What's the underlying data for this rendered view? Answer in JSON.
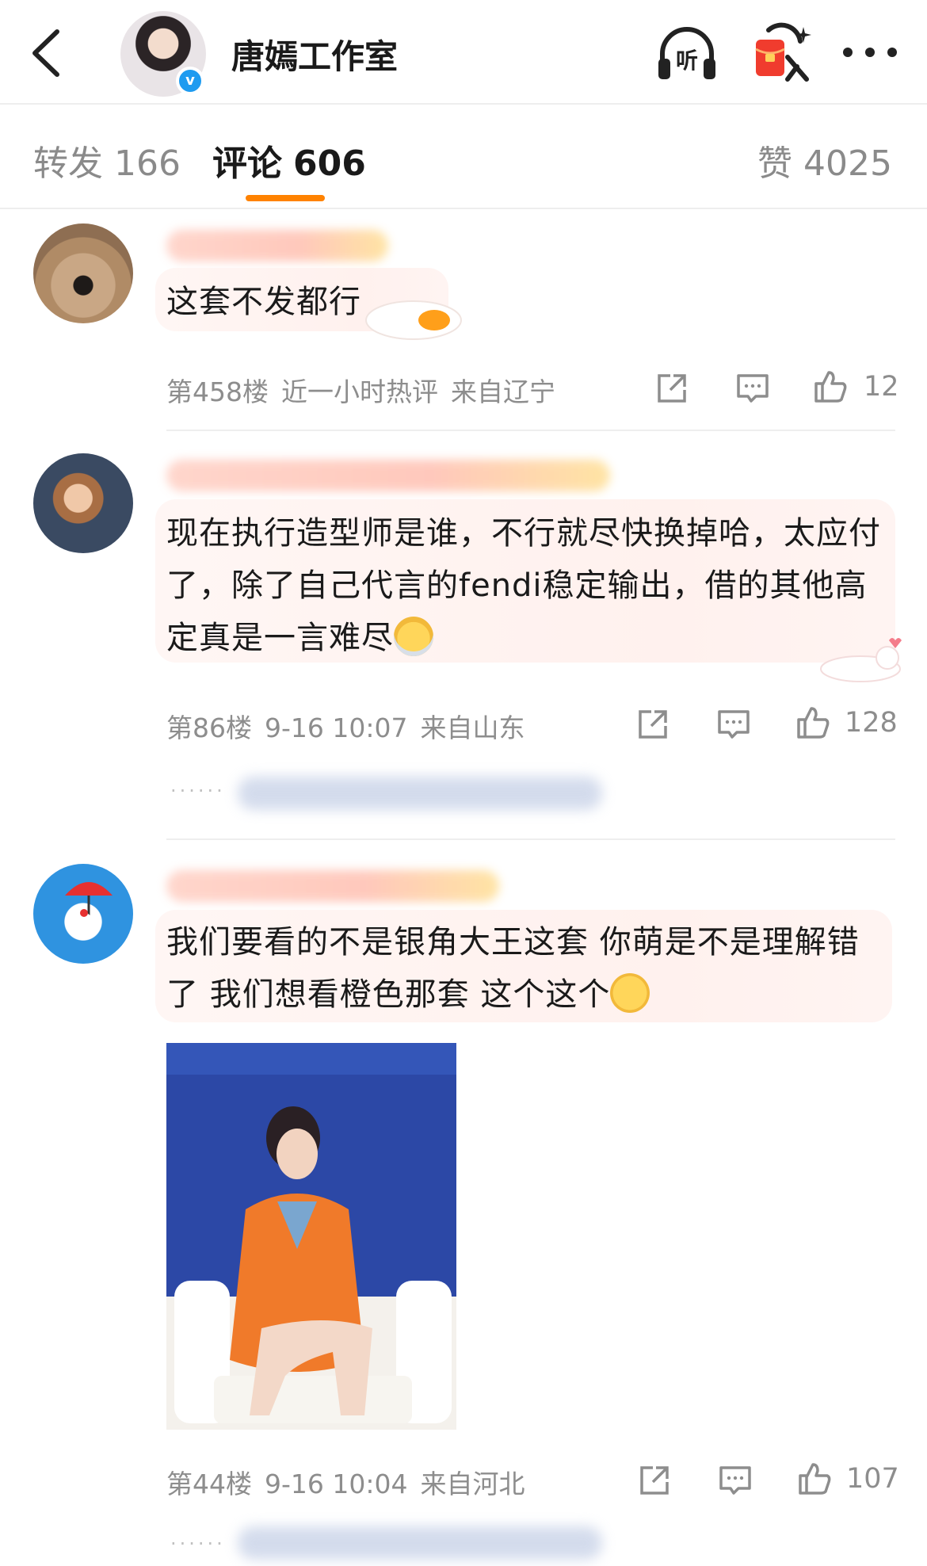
{
  "header": {
    "owner_name": "唐嫣工作室",
    "listen_label": "听",
    "icons": [
      "back-arrow-icon",
      "headphones-icon",
      "red-packet-icon",
      "more-icon"
    ]
  },
  "tabs": [
    {
      "label": "转发",
      "count": "166"
    },
    {
      "label": "评论",
      "count": "606"
    },
    {
      "label": "赞",
      "count": "4025"
    }
  ],
  "comments": [
    {
      "text": "这套不发都行",
      "floor": "第458楼",
      "time": "近一小时热评",
      "location": "来自辽宁",
      "likes": "12"
    },
    {
      "text": "现在执行造型师是谁，不行就尽快换掉哈，太应付了，除了自己代言的fendi稳定输出，借的其他高定真是一言难尽",
      "floor": "第86楼",
      "time": "9-16 10:07",
      "location": "来自山东",
      "likes": "128"
    },
    {
      "text": "我们要看的不是银角大王这套 你萌是不是理解错了 我们想看橙色那套 这个这个",
      "floor": "第44楼",
      "time": "9-16 10:04",
      "location": "来自河北",
      "likes": "107"
    }
  ]
}
